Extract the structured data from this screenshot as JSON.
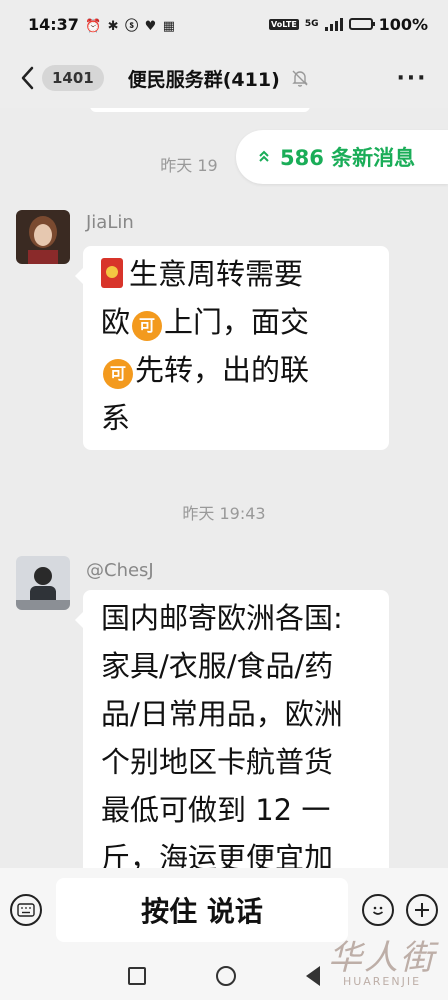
{
  "status_bar": {
    "time": "14:37",
    "icons": "⏰ ✱ ⓢ ♥ ▦",
    "network": "VoLTE",
    "net_gen": "5G",
    "battery": "100%",
    "battery_level": 1.0
  },
  "header": {
    "back_badge": "1401",
    "title": "便民服务群(411)",
    "more": "···"
  },
  "new_messages_pill": {
    "text": "586 条新消息"
  },
  "messages": [
    {
      "time_label": "昨天 19",
      "sender": "JiaLin",
      "lines": [
        {
          "parts": [
            {
              "t": "redpacket"
            },
            {
              "t": "text",
              "v": "生意周转需要"
            }
          ]
        },
        {
          "parts": [
            {
              "t": "text",
              "v": "欧"
            },
            {
              "t": "coin",
              "v": "可"
            },
            {
              "t": "text",
              "v": "上门，面交"
            }
          ]
        },
        {
          "parts": [
            {
              "t": "coin",
              "v": "可"
            },
            {
              "t": "text",
              "v": "先转，出的联"
            }
          ]
        },
        {
          "parts": [
            {
              "t": "text",
              "v": "系"
            }
          ]
        }
      ]
    },
    {
      "time_label": "昨天 19:43",
      "sender": "@ChesJ",
      "lines": [
        {
          "parts": [
            {
              "t": "text",
              "v": "国内邮寄欧洲各国:"
            }
          ]
        },
        {
          "parts": [
            {
              "t": "text",
              "v": "家具/衣服/食品/药"
            }
          ]
        },
        {
          "parts": [
            {
              "t": "text",
              "v": "品/日常用品，欧洲"
            }
          ]
        },
        {
          "parts": [
            {
              "t": "text",
              "v": "个别地区卡航普货"
            }
          ]
        },
        {
          "parts": [
            {
              "t": "text",
              "v": "最低可做到 12 一"
            }
          ]
        },
        {
          "parts": [
            {
              "t": "text",
              "v": "斤，海运更便宜加"
            }
          ]
        }
      ]
    }
  ],
  "input_bar": {
    "hold_to_talk": "按住 说话"
  },
  "watermark": {
    "cn": "华人街",
    "en": "HUARENJIE"
  },
  "colors": {
    "accent_green": "#1aad58",
    "background": "#ececec",
    "redpacket": "#d8342a",
    "coin": "#f39a1e"
  }
}
